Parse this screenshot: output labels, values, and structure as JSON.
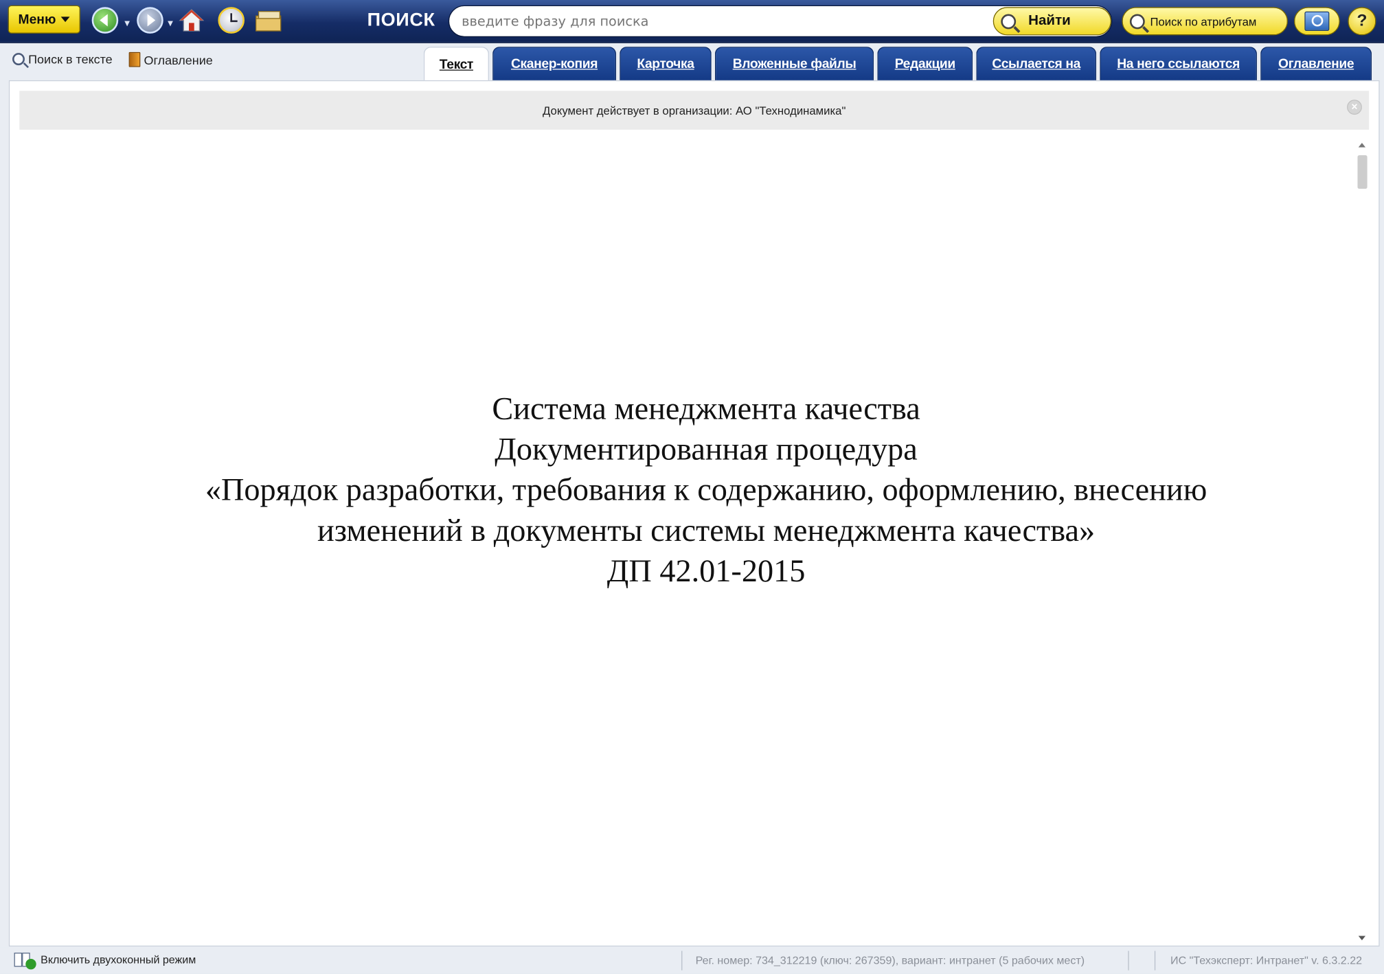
{
  "toolbar": {
    "menu_label": "Меню",
    "search_section_label": "ПОИСК",
    "search_placeholder": "введите фразу для поиска",
    "find_label": "Найти",
    "attr_search_label": "Поиск по атрибутам",
    "help_label": "?"
  },
  "subbar": {
    "search_in_text_label": "Поиск в тексте",
    "toc_label": "Оглавление"
  },
  "tabs": [
    {
      "label": "Текст",
      "active": true
    },
    {
      "label": "Сканер-копия"
    },
    {
      "label": "Карточка"
    },
    {
      "label": "Вложенные файлы"
    },
    {
      "label": "Редакции"
    },
    {
      "label": "Ссылается на"
    },
    {
      "label": "На него ссылаются"
    },
    {
      "label": "Оглавление"
    }
  ],
  "notice": {
    "text": "Документ действует в организации: АО \"Технодинамика\"",
    "close_label": "×"
  },
  "document": {
    "title_lines": [
      "Система менеджмента качества",
      "Документированная процедура",
      "«Порядок разработки, требования к содержанию, оформлению, внесению",
      "изменений в документы системы менеджмента качества»",
      "ДП 42.01-2015"
    ]
  },
  "status": {
    "dual_mode_label": "Включить двухоконный режим",
    "reg_info": "Рег. номер: 734_312219 (ключ: 267359), вариант: интранет (5 рабочих мест)",
    "version_info": "ИС \"Техэксперт: Интранет\" v. 6.3.2.22"
  },
  "colors": {
    "toolbar_bg": "#152c66",
    "tab_bg": "#1e4896",
    "button_yellow": "#f1d928"
  }
}
